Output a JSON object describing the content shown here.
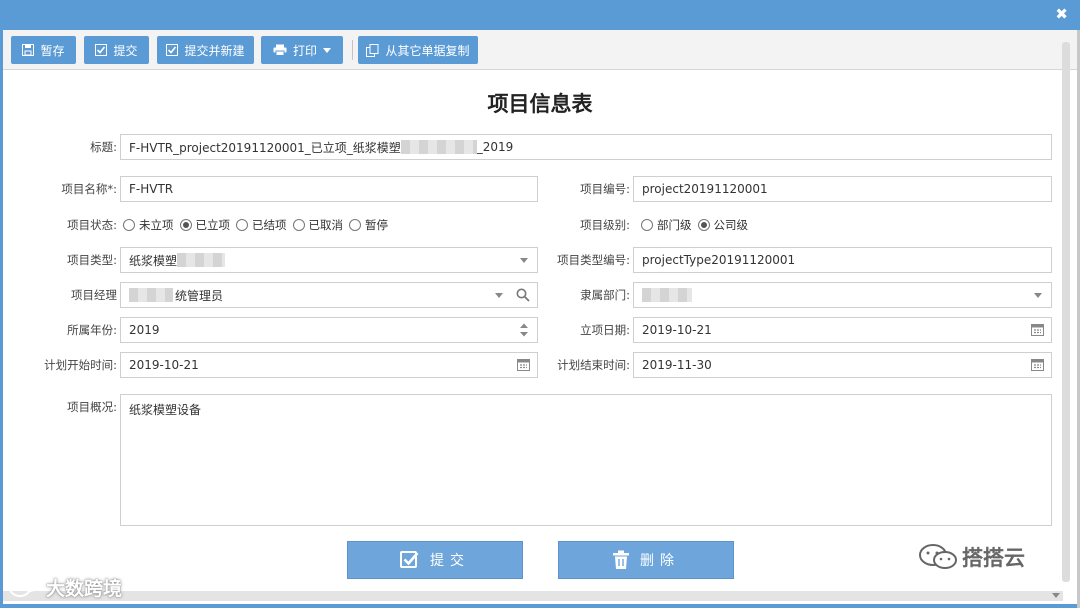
{
  "window": {
    "close_glyph": "✖"
  },
  "toolbar": {
    "save_draft": "暂存",
    "submit": "提交",
    "submit_new": "提交并新建",
    "print": "打印",
    "copy_from": "从其它单据复制"
  },
  "form": {
    "title": "项目信息表",
    "labels": {
      "title": "标题:",
      "name": "项目名称*:",
      "code": "项目编号:",
      "status": "项目状态:",
      "level": "项目级别:",
      "type": "项目类型:",
      "type_code": "项目类型编号:",
      "manager": "项目经理",
      "dept": "隶属部门:",
      "year": "所属年份:",
      "setup_date": "立项日期:",
      "plan_start": "计划开始时间:",
      "plan_end": "计划结束时间:",
      "overview": "项目概况:"
    },
    "values": {
      "title_prefix": "F-HVTR_project20191120001_已立项_纸浆模塑",
      "title_suffix": "_2019",
      "name": "F-HVTR",
      "code": "project20191120001",
      "type": "纸浆模塑",
      "type_code": "projectType20191120001",
      "manager": "统管理员",
      "year": "2019",
      "setup_date": "2019-10-21",
      "plan_start": "2019-10-21",
      "plan_end": "2019-11-30",
      "overview": "纸浆模塑设备"
    },
    "status_options": [
      {
        "label": "未立项",
        "selected": false
      },
      {
        "label": "已立项",
        "selected": true
      },
      {
        "label": "已结项",
        "selected": false
      },
      {
        "label": "已取消",
        "selected": false
      },
      {
        "label": "暂停",
        "selected": false
      }
    ],
    "level_options": [
      {
        "label": "部门级",
        "selected": false
      },
      {
        "label": "公司级",
        "selected": true
      }
    ]
  },
  "actions": {
    "submit": "提交",
    "delete": "删除"
  },
  "watermarks": {
    "left": "大数跨境",
    "right": "搭搭云"
  },
  "colors": {
    "primary": "#5b9bd5",
    "button": "#6ea6dc"
  }
}
